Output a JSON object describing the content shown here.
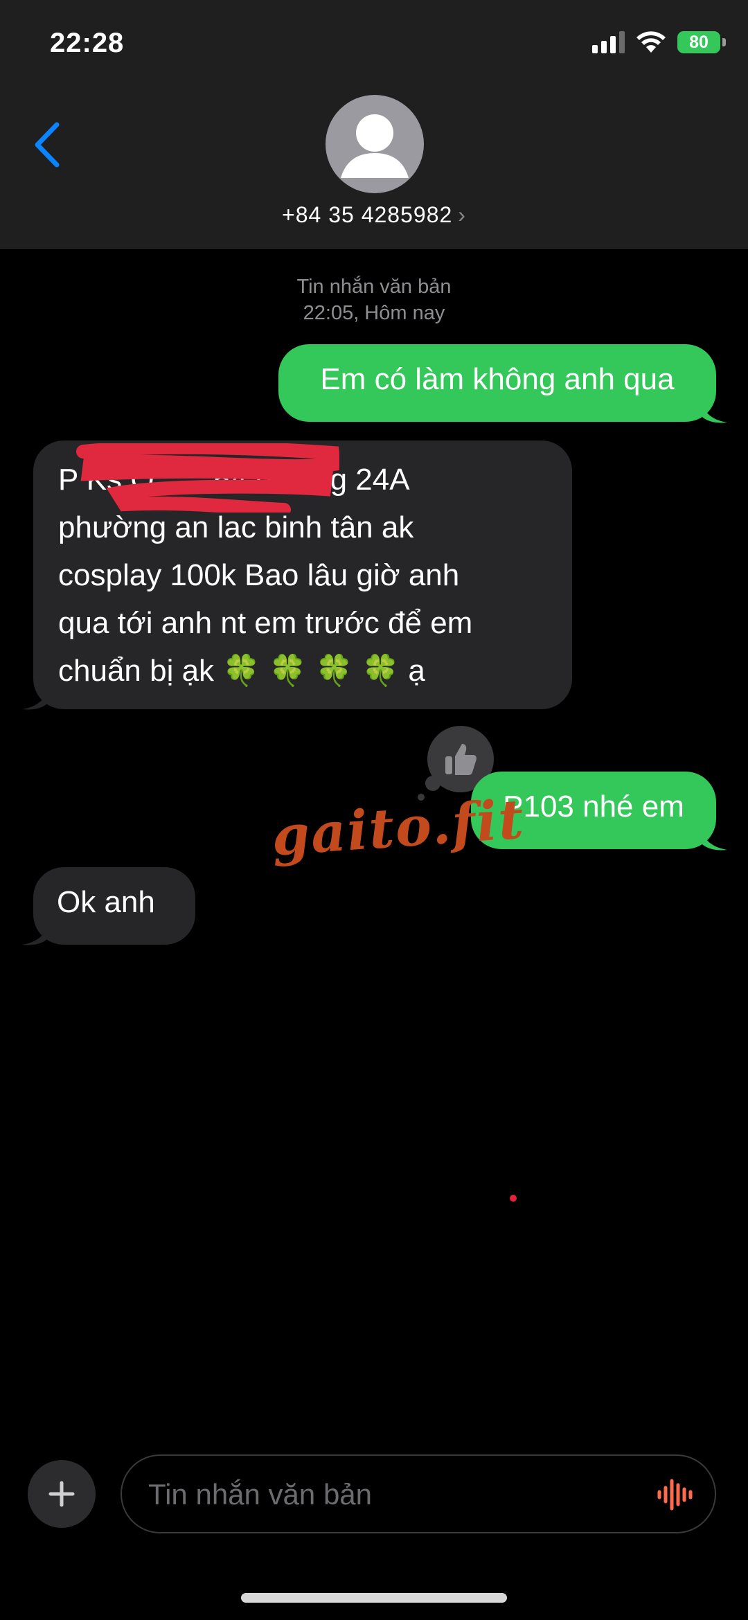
{
  "status_bar": {
    "time": "22:28",
    "battery": "80"
  },
  "header": {
    "contact": "+84 35 4285982",
    "chevron": "›"
  },
  "conversation": {
    "meta_line1": "Tin nhắn văn bản",
    "meta_line2": "22:05, Hôm nay",
    "messages": [
      {
        "direction": "outgoing",
        "text": "Em có làm không anh qua"
      },
      {
        "direction": "incoming",
        "lines": [
          "P Ks Q... ...54 đường 24A",
          "phường an lac binh tân ak",
          "cosplay 100k Bao lâu  giờ anh",
          "qua tới anh nt em trước để em",
          "chuẩn bị ạk 🍀 🍀 🍀 🍀 ạ"
        ]
      },
      {
        "direction": "outgoing",
        "text": "P103 nhé em",
        "tapback": "thumbs-up"
      },
      {
        "direction": "incoming",
        "text": "Ok anh"
      }
    ]
  },
  "watermark": "gaito.fit",
  "composer": {
    "placeholder": "Tin nhắn văn bản"
  },
  "icons": [
    "back-chevron-icon",
    "avatar-icon",
    "signal-icon",
    "wifi-icon",
    "battery-icon",
    "thumbs-up-icon",
    "plus-icon",
    "audio-wave-icon"
  ],
  "colors": {
    "outgoing_bubble": "#34c759",
    "incoming_bubble": "#262628",
    "accent": "#0a84ff",
    "audio_icon": "#ff6a4d"
  }
}
